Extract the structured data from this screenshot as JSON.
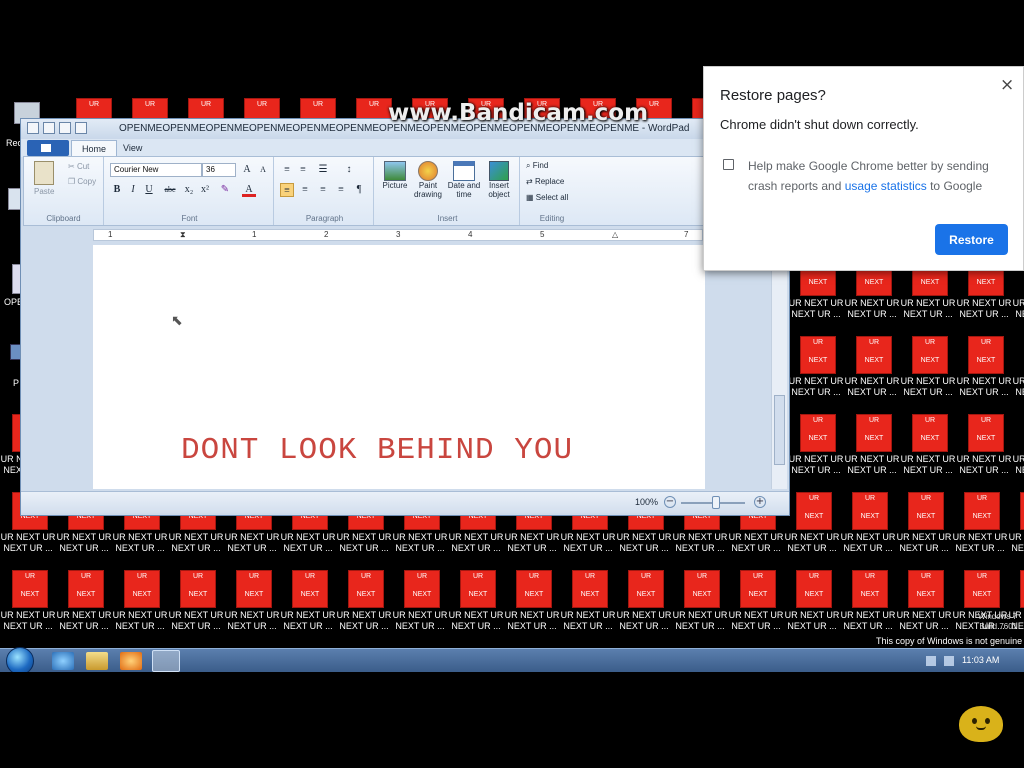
{
  "watermark": "www.Bandicam.com",
  "desktop_icons": {
    "top_label": "UR",
    "bottom_label": "NEXT",
    "caption_line1": "UR NEXT UR",
    "caption_line2": "NEXT UR ..."
  },
  "left_strip": {
    "recycle_label": "Rec",
    "open_label": "OPE",
    "pc_label": "P",
    "nex_label": "NEX"
  },
  "wordpad": {
    "title": "OPENMEOPENMEOPENMEOPENMEOPENMEOPENMEOPENMEOPENMEOPENMEOPENMEOPENMEOPENME - WordPad",
    "tabs": [
      "Home",
      "View"
    ],
    "clipboard": {
      "paste": "Paste",
      "cut": "Cut",
      "copy": "Copy",
      "group": "Clipboard"
    },
    "font": {
      "name": "Courier New",
      "size": "36",
      "group": "Font",
      "bold": "B",
      "italic": "I",
      "underline": "U",
      "strike": "abc",
      "sub": "x₂",
      "sup": "x²"
    },
    "paragraph": {
      "group": "Paragraph"
    },
    "insert": {
      "picture": "Picture",
      "paint": "Paint drawing",
      "datetime": "Date and time",
      "object": "Insert object",
      "group": "Insert"
    },
    "editing": {
      "find": "Find",
      "replace": "Replace",
      "select_all": "Select all",
      "group": "Editing"
    },
    "ruler_marks": [
      "1",
      "1",
      "2",
      "3",
      "4",
      "5",
      "6",
      "7"
    ],
    "document_text": "DONT LOOK BEHIND YOU",
    "zoom": "100%"
  },
  "chrome_dialog": {
    "title": "Restore pages?",
    "message": "Chrome didn't shut down correctly.",
    "checkbox_text_before": "Help make Google Chrome better by sending crash reports and ",
    "checkbox_link": "usage statistics",
    "checkbox_text_after": " to Google",
    "button": "Restore",
    "close": "×"
  },
  "taskbar": {
    "clock": "11:03 AM",
    "genuine_notice": "This copy of Windows is not genuine",
    "build_line1": "Windows 7",
    "build_line2": "Build 7601"
  },
  "colors": {
    "icon_red": "#e8261c",
    "chrome_blue": "#1a73e8",
    "doc_text": "#c9463f"
  }
}
